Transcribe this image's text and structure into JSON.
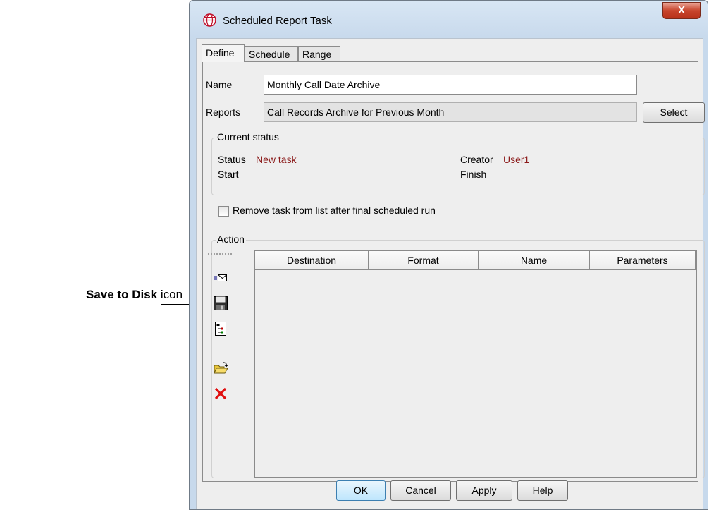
{
  "callout": {
    "bold": "Save to Disk",
    "rest": " icon"
  },
  "window": {
    "title": "Scheduled Report Task",
    "close_label": "X"
  },
  "tabs": [
    {
      "label": "Define",
      "active": true
    },
    {
      "label": "Schedule",
      "active": false
    },
    {
      "label": "Range",
      "active": false
    }
  ],
  "define": {
    "name_label": "Name",
    "name_value": "Monthly Call Date Archive",
    "reports_label": "Reports",
    "reports_value": "Call Records Archive for Previous Month",
    "select_label": "Select"
  },
  "current_status": {
    "title": "Current status",
    "status_label": "Status",
    "status_value": "New task",
    "creator_label": "Creator",
    "creator_value": "User1",
    "start_label": "Start",
    "finish_label": "Finish"
  },
  "remove_task_label": "Remove task from list after final scheduled run",
  "action": {
    "title": "Action",
    "columns": [
      "Destination",
      "Format",
      "Name",
      "Parameters"
    ],
    "toolbar_icons": [
      "email-icon",
      "save-to-disk-icon",
      "hierarchy-icon",
      "open-folder-icon",
      "delete-icon"
    ]
  },
  "buttons": {
    "ok": "OK",
    "cancel": "Cancel",
    "apply": "Apply",
    "help": "Help"
  },
  "colors": {
    "status_value": "#8b1a1a",
    "close_button": "#c8452c",
    "frame": "#c7d9ec"
  }
}
